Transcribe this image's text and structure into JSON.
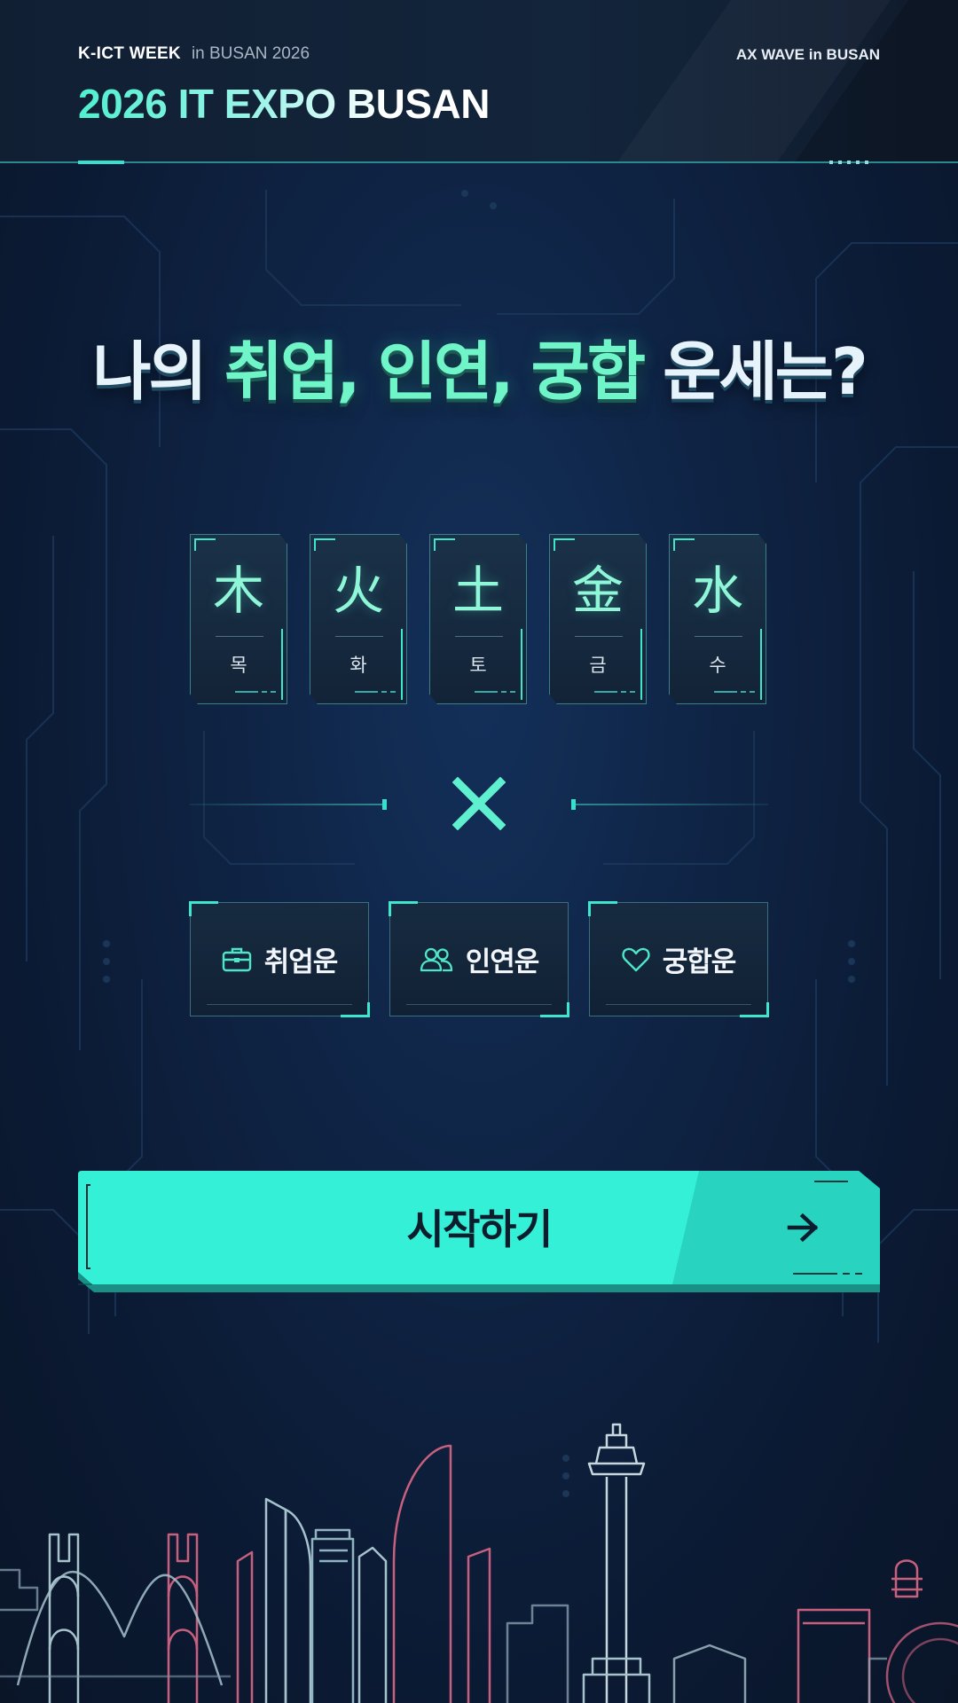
{
  "header": {
    "event_bold": "K-ICT WEEK",
    "event_light": "in BUSAN 2026",
    "title": "2026 IT EXPO BUSAN",
    "right_label": "AX WAVE in BUSAN"
  },
  "headline": {
    "part1": "나의",
    "part2": "취업,",
    "part3": "인연,",
    "part4": "궁합",
    "part5": "운세는?"
  },
  "elements": [
    {
      "hanja": "木",
      "korean": "목"
    },
    {
      "hanja": "火",
      "korean": "화"
    },
    {
      "hanja": "土",
      "korean": "토"
    },
    {
      "hanja": "金",
      "korean": "금"
    },
    {
      "hanja": "水",
      "korean": "수"
    }
  ],
  "fortunes": [
    {
      "label": "취업운",
      "icon": "briefcase-icon"
    },
    {
      "label": "인연운",
      "icon": "people-icon"
    },
    {
      "label": "궁합운",
      "icon": "heart-icon"
    }
  ],
  "start_button": {
    "label": "시작하기",
    "icon": "arrow-right-icon"
  },
  "colors": {
    "accent": "#36e0cc",
    "background": "#0f2445",
    "button": "#33f0d6"
  }
}
